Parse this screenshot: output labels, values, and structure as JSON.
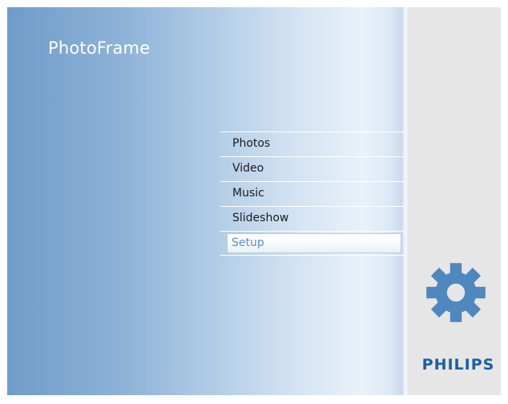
{
  "app": {
    "title": "PhotoFrame"
  },
  "menu": {
    "items": [
      {
        "label": "Photos"
      },
      {
        "label": "Video"
      },
      {
        "label": "Music"
      },
      {
        "label": "Slideshow"
      },
      {
        "label": "Setup"
      }
    ],
    "selected_label": "Setup"
  },
  "side_panel": {
    "icon": "gear-icon",
    "brand": "PHILIPS"
  },
  "colors": {
    "accent": "#5b8ec7",
    "brand": "#1b5fa6",
    "icon": "#4f87bf"
  }
}
